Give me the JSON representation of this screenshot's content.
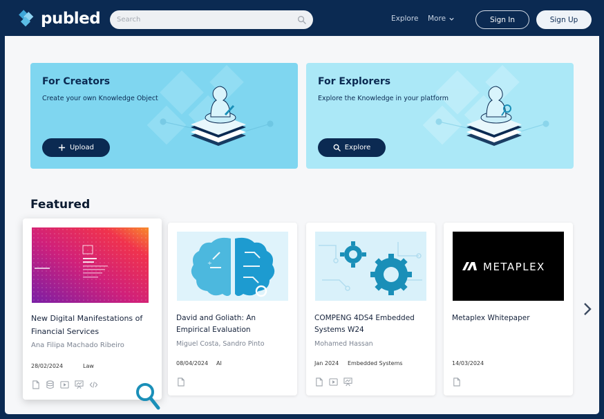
{
  "brand": {
    "name": "publed"
  },
  "header": {
    "search_placeholder": "Search",
    "nav": {
      "explore": "Explore",
      "more": "More"
    },
    "sign_in": "Sign In",
    "sign_up": "Sign Up"
  },
  "promos": [
    {
      "title": "For Creators",
      "subtitle": "Create your own Knowledge Object",
      "button": "Upload",
      "button_icon": "plus-icon"
    },
    {
      "title": "For Explorers",
      "subtitle": "Explore the Knowledge in your platform",
      "button": "Explore",
      "button_icon": "search-icon"
    }
  ],
  "featured": {
    "title": "Featured",
    "cards": [
      {
        "title": "New Digital Manifestations of Financial Services",
        "author": "Ana Filipa Machado Ribeiro",
        "date": "28/02/2024",
        "category": "Law",
        "icons": [
          "document-icon",
          "database-icon",
          "video-icon",
          "presentation-icon",
          "code-icon"
        ]
      },
      {
        "title": "David and Goliath: An Empirical Evaluation",
        "author": "Miguel Costa, Sandro Pinto",
        "date": "08/04/2024",
        "category": "AI",
        "icons": [
          "document-icon"
        ]
      },
      {
        "title": "COMPENG 4DS4 Embedded Systems W24",
        "author": "Mohamed Hassan",
        "date": "Jan 2024",
        "category": "Embedded Systems",
        "icons": [
          "document-icon",
          "video-icon",
          "presentation-icon"
        ]
      },
      {
        "title": "Metaplex Whitepaper",
        "author": "",
        "date": "14/03/2024",
        "category": "",
        "icons": [
          "document-icon"
        ],
        "thumb_text": "METAPLEX"
      }
    ]
  },
  "colors": {
    "navy": "#0b2a52",
    "creators_bg": "#7fd6f0",
    "explorers_bg": "#abe8f7",
    "accent": "#1a8fb8"
  }
}
